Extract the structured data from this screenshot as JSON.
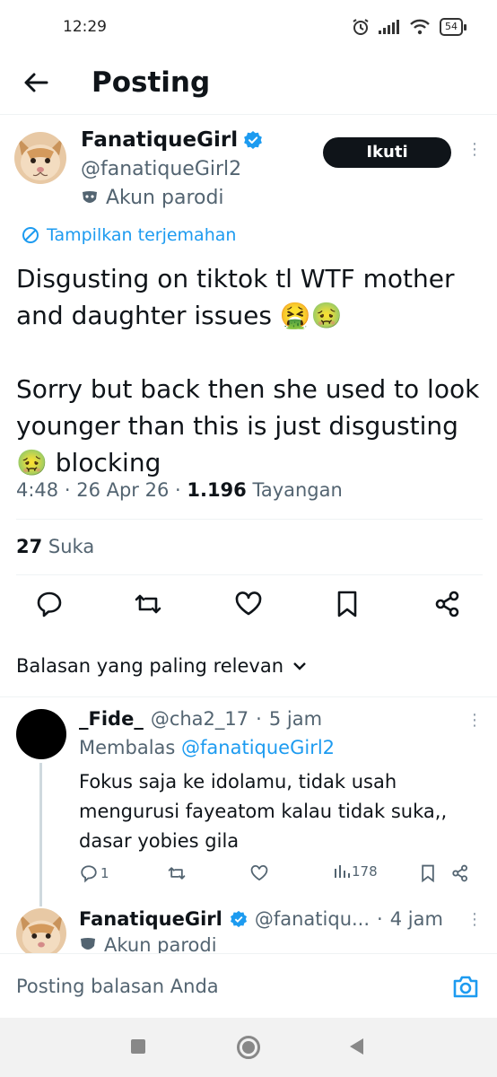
{
  "status_bar": {
    "time": "12:29",
    "battery": "54"
  },
  "header": {
    "title": "Posting"
  },
  "post": {
    "author_name": "FanatiqueGirl",
    "author_handle": "@fanatiqueGirl2",
    "parody_label": "Akun parodi",
    "follow_label": "Ikuti",
    "translate_label": "Tampilkan terjemahan",
    "paragraph_1": "Disgusting on tiktok tl WTF mother and daughter issues 🤮🤢",
    "paragraph_2": "Sorry but back then she used to look younger than this is just disgusting 🤢 blocking",
    "time": "4:48",
    "date": "26 Apr 26",
    "views_count": "1.196",
    "views_label": "Tayangan",
    "likes_count": "27",
    "likes_label": "Suka"
  },
  "replies_sort": {
    "label": "Balasan yang paling relevan"
  },
  "reply_1": {
    "name": "_Fide_",
    "handle": "@cha2_17",
    "age": "5 jam",
    "replying_prefix": "Membalas",
    "replying_to": "@fanatiqueGirl2",
    "text": "Fokus saja ke idolamu, tidak usah mengurusi fayeatom kalau tidak suka,, dasar yobies gila",
    "reply_count": "1",
    "view_count": "178"
  },
  "reply_2": {
    "name": "FanatiqueGirl",
    "handle": "@fanatiqu...",
    "age": "4 jam",
    "parody_label": "Akun parodi"
  },
  "compose": {
    "placeholder": "Posting balasan Anda"
  },
  "colors": {
    "accent": "#1d9bf0",
    "text": "#0f1419",
    "secondary": "#536471"
  }
}
